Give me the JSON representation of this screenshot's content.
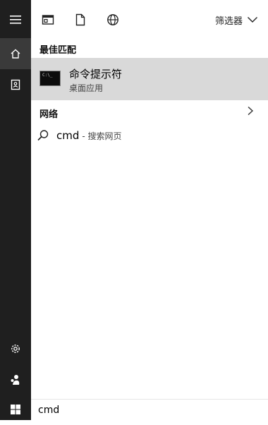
{
  "rail": {
    "items": [
      {
        "icon": "hamburger-menu-icon"
      },
      {
        "icon": "home-icon"
      },
      {
        "icon": "notebook-icon"
      },
      {
        "icon": "gear-icon"
      },
      {
        "icon": "people-icon"
      },
      {
        "icon": "windows-start-icon"
      }
    ]
  },
  "filter_bar": {
    "icons": [
      "apps-icon",
      "document-icon",
      "web-globe-icon"
    ],
    "filter_label": "筛选器"
  },
  "best_match": {
    "title": "最佳匹配",
    "app_name": "命令提示符",
    "app_type": "桌面应用",
    "icon_text": "C:\\_"
  },
  "web": {
    "title": "网络",
    "query": "cmd",
    "suffix": "- 搜索网页"
  },
  "search": {
    "value": "cmd"
  }
}
